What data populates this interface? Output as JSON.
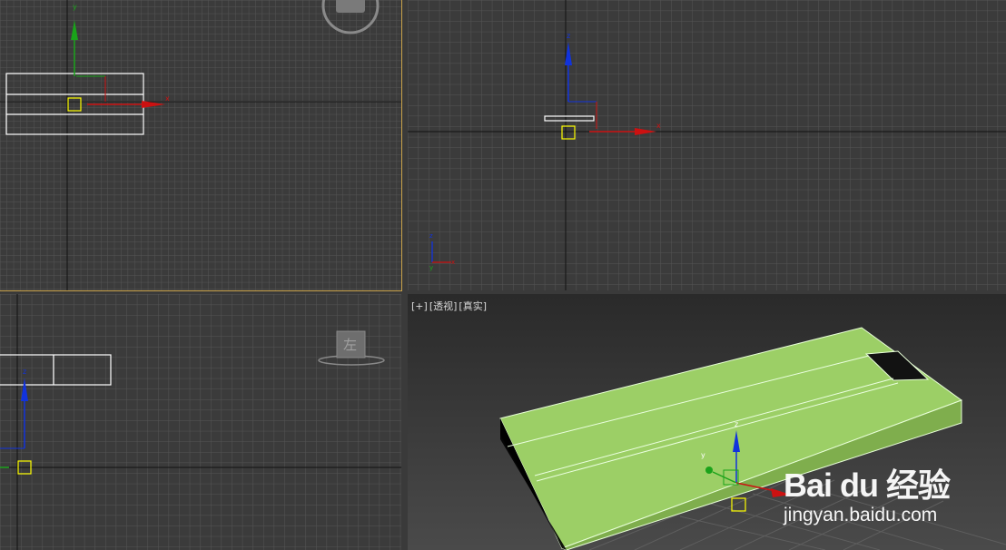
{
  "viewports": {
    "persp_label": {
      "plus": "[+]",
      "view": "[透视]",
      "shading": "[真实]"
    },
    "left_cube_label": "左"
  },
  "watermark": {
    "brand": "Bai du 经验",
    "url": "jingyan.baidu.com"
  },
  "colors": {
    "active_border": "#c9a24a",
    "model_fill": "#9ccf66",
    "x_axis": "#cc1111",
    "y_axis": "#1aa31a",
    "z_axis": "#1133dd"
  }
}
